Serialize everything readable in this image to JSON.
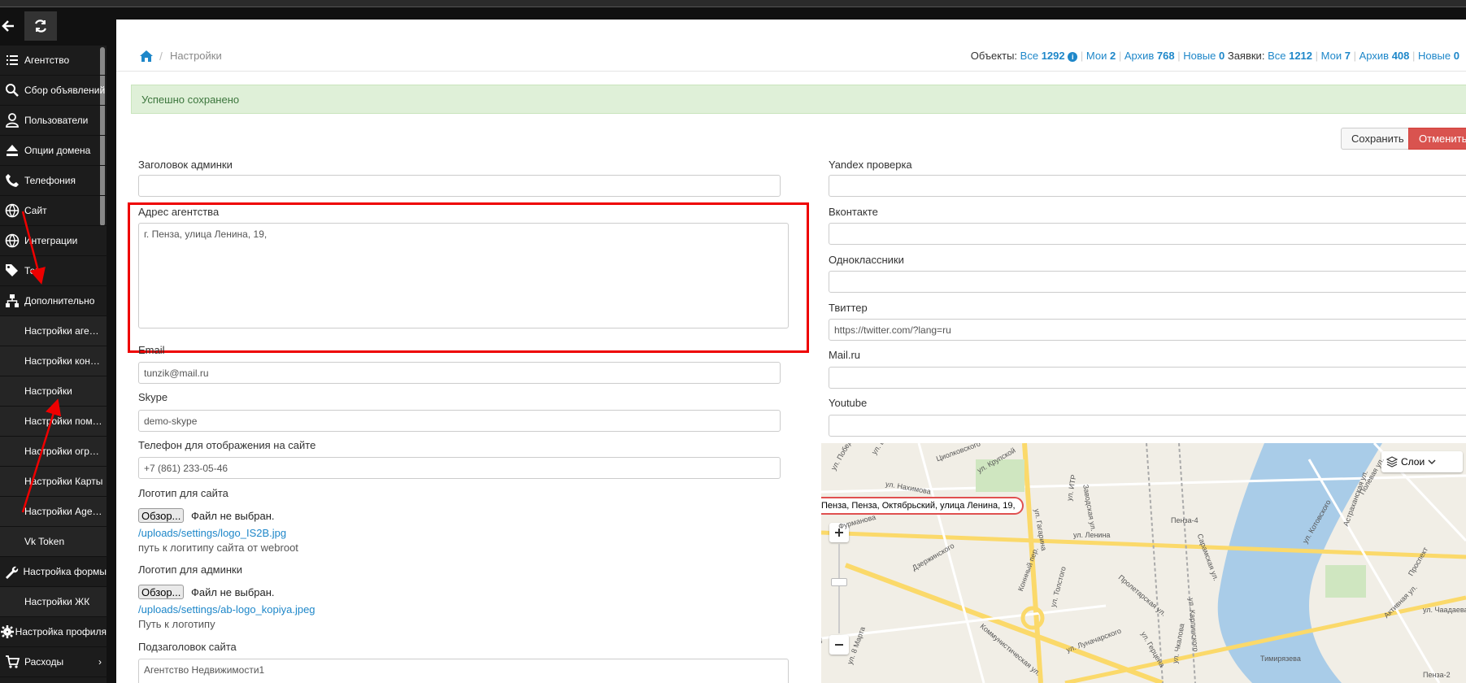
{
  "sidebar": {
    "items": [
      {
        "label": "Агентство",
        "icon": "list-icon"
      },
      {
        "label": "Сбор объявлений",
        "icon": "search-icon"
      },
      {
        "label": "Пользователи",
        "icon": "user-icon"
      },
      {
        "label": "Опции домена",
        "icon": "eject-icon"
      },
      {
        "label": "Телефония",
        "icon": "phone-icon"
      },
      {
        "label": "Сайт",
        "icon": "globe-icon"
      },
      {
        "label": "Интеграции",
        "icon": "globe-icon"
      },
      {
        "label": "Теги",
        "icon": "tags-icon"
      },
      {
        "label": "Дополнительно",
        "icon": "sitemap-icon"
      },
      {
        "label": "Настройки агентства",
        "sub": true
      },
      {
        "label": "Настройки контрагентов",
        "sub": true
      },
      {
        "label": "Настройки",
        "sub": true
      },
      {
        "label": "Настройки помощника",
        "sub": true
      },
      {
        "label": "Настройки ограничений",
        "sub": true
      },
      {
        "label": "Настройки Карты",
        "sub": true
      },
      {
        "label": "Настройки Agency",
        "sub": true
      },
      {
        "label": "Vk Token",
        "sub": true
      },
      {
        "label": "Настройка формы",
        "icon": "wrench-icon"
      },
      {
        "label": "Настройки ЖК",
        "sub": true
      },
      {
        "label": "Настройка профиля",
        "icon": "gear-icon"
      },
      {
        "label": "Расходы",
        "icon": "cart-icon"
      }
    ]
  },
  "breadcrumb": {
    "current": "Настройки"
  },
  "stats": {
    "objects_label": "Объекты:",
    "all": "Все",
    "all_count": "1292",
    "mine": "Мои",
    "mine_count": "2",
    "archive": "Архив",
    "archive_count": "768",
    "new": "Новые",
    "new_count": "0",
    "requests_label": "Заявки:",
    "r_all": "Все",
    "r_all_count": "1212",
    "r_mine": "Мои",
    "r_mine_count": "7",
    "r_archive": "Архив",
    "r_archive_count": "408",
    "r_new": "Новые",
    "r_new_count": "0"
  },
  "alert": "Успешно сохранено",
  "buttons": {
    "save": "Сохранить",
    "cancel": "Отменить"
  },
  "left_form": {
    "admin_title_label": "Заголовок админки",
    "admin_title_value": "",
    "address_label": "Адрес агентства",
    "address_value": "г. Пенза, улица Ленина, 19,",
    "email_label": "Email",
    "email_value": "tunzik@mail.ru",
    "skype_label": "Skype",
    "skype_value": "demo-skype",
    "phone_label": "Телефон для отображения на сайте",
    "phone_value": "+7 (861) 233-05-46",
    "logo_label": "Логотип для сайта",
    "browse": "Обзор...",
    "no_file": "Файл не выбран.",
    "logo_link": "/uploads/settings/logo_IS2B.jpg",
    "logo_help": "путь к логитипу сайта от webroot",
    "admin_logo_label": "Логотип для админки",
    "admin_logo_link": "/uploads/settings/ab-logo_kopiya.jpeg",
    "admin_logo_help": "Путь к логотипу",
    "subtitle_label": "Подзаголовок сайта",
    "subtitle_value": "Агентство Недвижимости1"
  },
  "right_form": {
    "yandex_label": "Yandex проверка",
    "vk_label": "Вконтакте",
    "ok_label": "Одноклассники",
    "twitter_label": "Твиттер",
    "twitter_value": "https://twitter.com/?lang=ru",
    "mailru_label": "Mail.ru",
    "youtube_label": "Youtube"
  },
  "map": {
    "balloon": "Пенза, Пенза, Октябрьский, улица Ленина, 19,",
    "layers": "Слои",
    "labels": [
      "ул. Победы",
      "ул. Белинского",
      "Циолковского",
      "ул. Крупской",
      "ул. Нахимова",
      "ул. Гагарина",
      "ул. ИТР",
      "Заводская ул.",
      "Пенза-4",
      "Сарамская ул.",
      "ул. Котовского",
      "Астраханская ул.",
      "Полевая ул.",
      "ул. Ленина",
      "Фурманова",
      "ул. Толстого",
      "Пролетарская ул.",
      "ул. Карпинского",
      "ул. Лунача­рского",
      "ул. Герцена",
      "ул. Чаадаева",
      "Проспект",
      "Коммунистическая ул.",
      "ул. 8 Марта",
      "Марта",
      "Тимирязева",
      "Пенза-2",
      "ул. Чкалова",
      "Активная ул.",
      "Коннный пер.",
      "Дзержинского"
    ]
  }
}
